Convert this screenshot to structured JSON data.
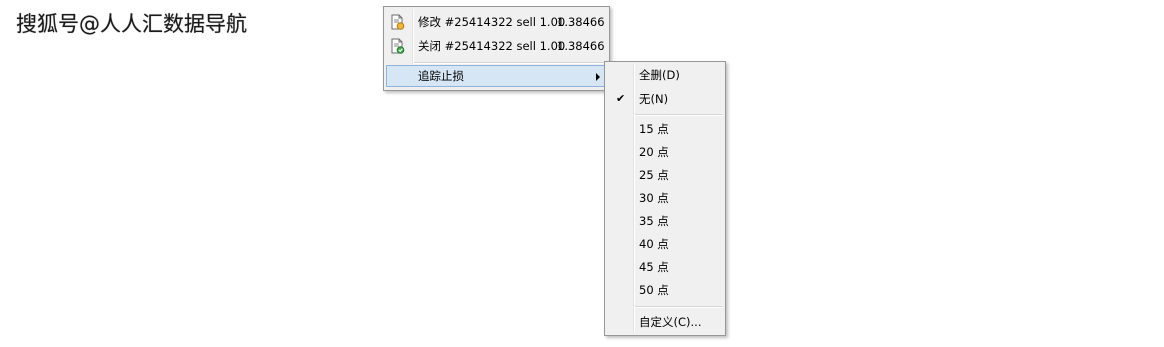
{
  "watermark": "搜狐号@人人汇数据导航",
  "main_menu": {
    "items": [
      {
        "label": "修改 #25414322 sell 1.00",
        "price": "1.38466",
        "icon": "document-edit-icon"
      },
      {
        "label": "关闭 #25414322 sell 1.00",
        "price": "1.38466",
        "icon": "document-close-icon"
      },
      {
        "label": "追踪止损",
        "submenu": true
      }
    ]
  },
  "sub_menu": {
    "delete_all": "全删(D)",
    "none": "无(N)",
    "points": [
      "15 点",
      "20 点",
      "25 点",
      "30 点",
      "35 点",
      "40 点",
      "45 点",
      "50 点"
    ],
    "custom": "自定义(C)...",
    "checked_item": "无(N)"
  },
  "colors": {
    "menu_bg": "#f0f0f0",
    "menu_border": "#979797",
    "highlight_bg": "#d6e6f5",
    "highlight_border": "#8fb4dc"
  }
}
